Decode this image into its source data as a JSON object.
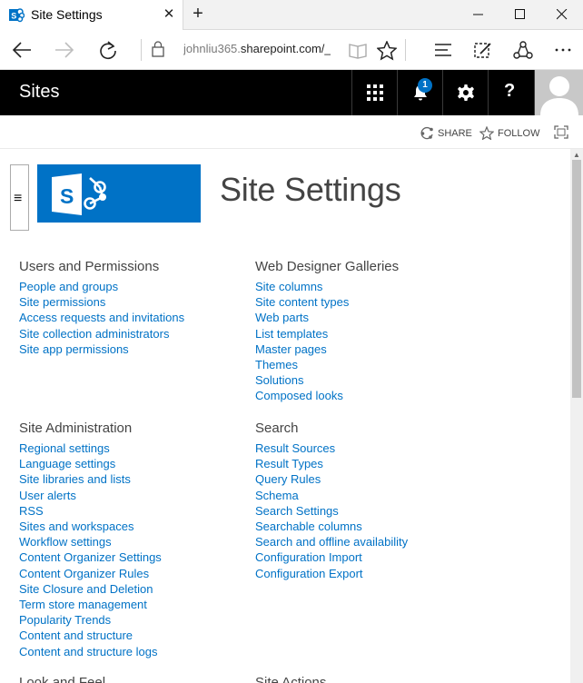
{
  "browser": {
    "tab_title": "Site Settings",
    "new_tab_glyph": "+",
    "close_glyph": "✕",
    "url_prefix": "johnliu365.",
    "url_host": "sharepoint.com/_",
    "icons": [
      "back-arrow-icon",
      "forward-arrow-icon",
      "refresh-icon",
      "lock-icon",
      "reading-view-icon",
      "favorite-star-icon",
      "hub-icon",
      "web-note-icon",
      "share-icon",
      "more-icon"
    ]
  },
  "suitebar": {
    "title": "Sites",
    "notification_count": "1",
    "help_glyph": "?"
  },
  "actions": {
    "share": "SHARE",
    "follow": "FOLLOW"
  },
  "page": {
    "title": "Site Settings",
    "menu_glyph": "≡"
  },
  "sections": {
    "users": {
      "heading": "Users and Permissions",
      "links": [
        "People and groups",
        "Site permissions",
        "Access requests and invitations",
        "Site collection administrators",
        "Site app permissions"
      ]
    },
    "galleries": {
      "heading": "Web Designer Galleries",
      "links": [
        "Site columns",
        "Site content types",
        "Web parts",
        "List templates",
        "Master pages",
        "Themes",
        "Solutions",
        "Composed looks"
      ]
    },
    "admin": {
      "heading": "Site Administration",
      "links": [
        "Regional settings",
        "Language settings",
        "Site libraries and lists",
        "User alerts",
        "RSS",
        "Sites and workspaces",
        "Workflow settings",
        "Content Organizer Settings",
        "Content Organizer Rules",
        "Site Closure and Deletion",
        "Term store management",
        "Popularity Trends",
        "Content and structure",
        "Content and structure logs"
      ]
    },
    "search": {
      "heading": "Search",
      "links": [
        "Result Sources",
        "Result Types",
        "Query Rules",
        "Schema",
        "Search Settings",
        "Searchable columns",
        "Search and offline availability",
        "Configuration Import",
        "Configuration Export"
      ]
    },
    "lookfeel": {
      "heading": "Look and Feel"
    },
    "siteactions": {
      "heading": "Site Actions"
    }
  },
  "colors": {
    "suitebar_bg": "#000000",
    "brand_blue": "#0072c6",
    "link": "#0072c6"
  }
}
